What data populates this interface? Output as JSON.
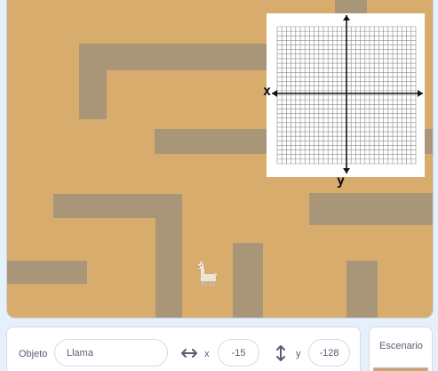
{
  "stage": {
    "background_color": "#d8ac6c",
    "wall_color": "#a99679",
    "grid_axis_x_label": "x",
    "grid_axis_y_label": "y",
    "sprite_icon": "llama-icon"
  },
  "sprite_info": {
    "sprite_label": "Objeto",
    "sprite_name": "Llama",
    "x_icon": "horizontal-arrows-icon",
    "x_label": "x",
    "x_value": "-15",
    "y_icon": "vertical-arrows-icon",
    "y_label": "y",
    "y_value": "-128"
  },
  "stage_panel": {
    "title": "Escenario"
  }
}
